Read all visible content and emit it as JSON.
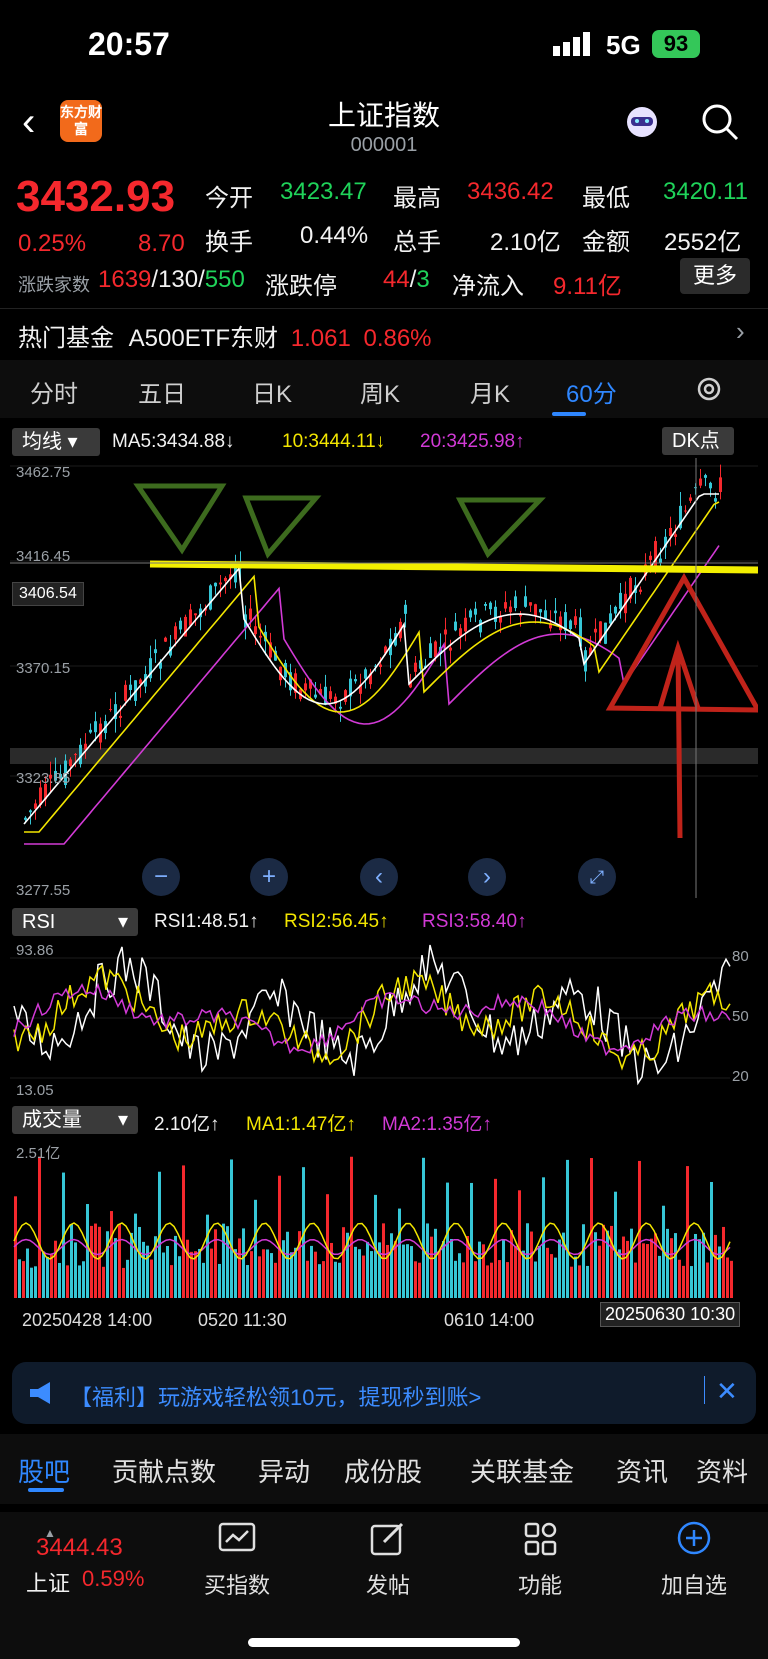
{
  "status": {
    "time": "20:57",
    "network": "5G",
    "battery": "93"
  },
  "nav": {
    "back_icon": "chevron-left-icon",
    "logo_text": "东方财富",
    "title": "上证指数",
    "code": "000001"
  },
  "quote": {
    "price": "3432.93",
    "change_pct": "0.25%",
    "change": "8.70",
    "open_label": "今开",
    "open": "3423.47",
    "high_label": "最高",
    "high": "3436.42",
    "low_label": "最低",
    "low": "3420.11",
    "turnover_label": "换手",
    "turnover": "0.44%",
    "volume_label": "总手",
    "volume": "2.10亿",
    "amount_label": "金额",
    "amount": "2552亿",
    "updown_label": "涨跌家数",
    "up": "1639",
    "flat": "130",
    "down": "550",
    "limit_label": "涨跌停",
    "limit_up": "44",
    "limit_down": "3",
    "netflow_label": "净流入",
    "netflow": "9.11亿",
    "more_label": "更多"
  },
  "hotfund": {
    "label": "热门基金",
    "name": "A500ETF东财",
    "price": "1.061",
    "pct": "0.86%"
  },
  "tabs": [
    "分时",
    "五日",
    "日K",
    "周K",
    "月K",
    "60分"
  ],
  "main_chart": {
    "indicator_tag": "均线",
    "ma5": "MA5:3434.88↓",
    "ma10": "10:3444.11↓",
    "ma20": "20:3425.98↑",
    "dk_tag": "DK点",
    "y_top": "3462.75",
    "y_2": "3416.45",
    "y_ref": "3406.54",
    "y_3": "3370.15",
    "y_4": "3323.85",
    "y_bottom": "3277.55"
  },
  "rsi_chart": {
    "tag": "RSI",
    "rsi1": "RSI1:48.51↑",
    "rsi2": "RSI2:56.45↑",
    "rsi3": "RSI3:58.40↑",
    "y_top": "93.86",
    "y_bottom": "13.05",
    "r80": "80",
    "r50": "50",
    "r20": "20"
  },
  "vol_chart": {
    "tag": "成交量",
    "vol": "2.10亿↑",
    "ma1": "MA1:1.47亿↑",
    "ma2": "MA2:1.35亿↑",
    "y_top": "2.51亿",
    "x1": "20250428 14:00",
    "x2": "0520 11:30",
    "x3": "0610 14:00",
    "x4": "20250630 10:30"
  },
  "promo": {
    "text": "【福利】玩游戏轻松领10元，提现秒到账>"
  },
  "subtabs": [
    "股吧",
    "贡献点数",
    "异动",
    "成份股",
    "关联基金",
    "资讯",
    "资料"
  ],
  "bottom": {
    "index_price": "3444.43",
    "index_name": "上证",
    "index_pct": "0.59%",
    "buy": "买指数",
    "post": "发帖",
    "func": "功能",
    "add": "加自选"
  },
  "colors": {
    "up": "#f5282d",
    "down": "#1fd35a",
    "accent": "#2f87ff",
    "ma5": "#ffffff",
    "ma10": "#f3e600",
    "ma20": "#d23ad6",
    "vol_down": "#36c6d6"
  }
}
